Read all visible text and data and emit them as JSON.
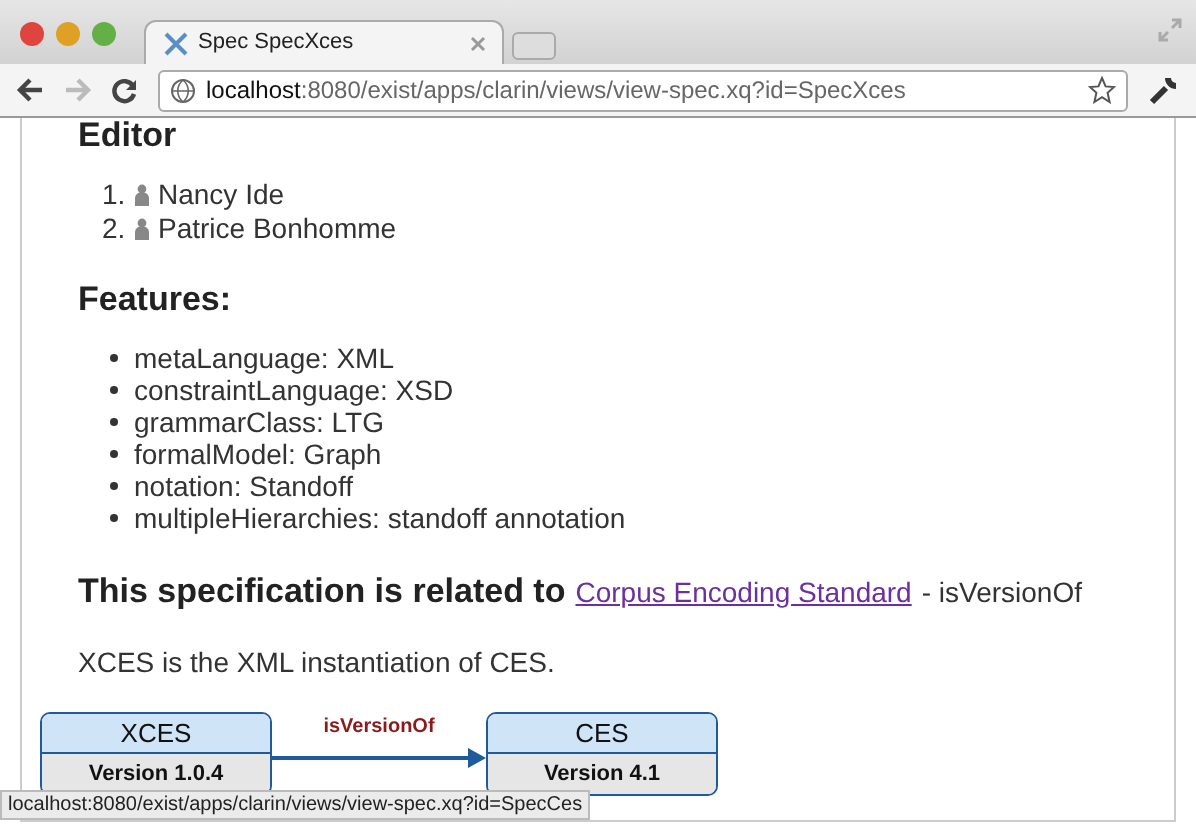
{
  "browser": {
    "tab": {
      "title": "Spec SpecXces",
      "selected": true
    },
    "address": {
      "host": "localhost",
      "path": ":8080/exist/apps/clarin/views/view-spec.xq?id=SpecXces"
    }
  },
  "page": {
    "editor_heading": "Editor",
    "editors": [
      {
        "number": "1.",
        "name": "Nancy Ide"
      },
      {
        "number": "2.",
        "name": "Patrice Bonhomme"
      }
    ],
    "features_heading": "Features:",
    "features": [
      "metaLanguage: XML",
      "constraintLanguage: XSD",
      "grammarClass: LTG",
      "formalModel: Graph",
      "notation: Standoff",
      "multipleHierarchies: standoff annotation"
    ],
    "related": {
      "heading": "This specification is related to",
      "link": "Corpus Encoding Standard",
      "relation": "- isVersionOf"
    },
    "description": "XCES is the XML instantiation of CES.",
    "diagram": {
      "source": {
        "name": "XCES",
        "version": "Version 1.0.4"
      },
      "edge": "isVersionOf",
      "target": {
        "name": "CES",
        "version": "Version 4.1"
      }
    }
  },
  "status_bar": "localhost:8080/exist/apps/clarin/views/view-spec.xq?id=SpecCes"
}
